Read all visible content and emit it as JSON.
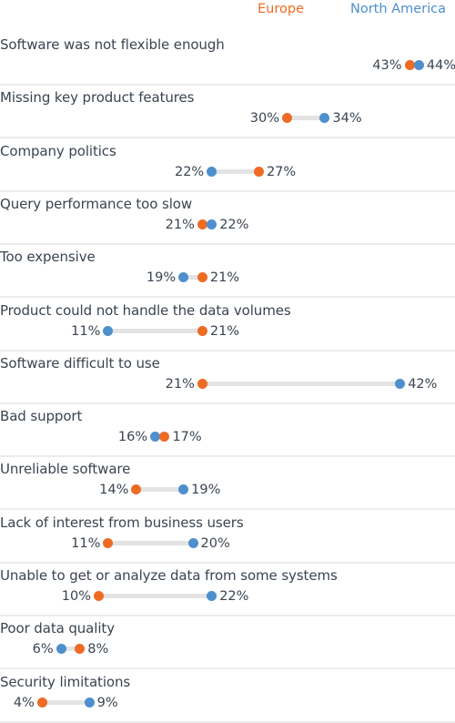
{
  "legend": {
    "europe_label": "Europe",
    "north_america_label": "North America"
  },
  "colors": {
    "europe": "#ee6b24",
    "north_america": "#4e8fce",
    "track": "#e3e3e3",
    "text": "#3a4450",
    "divider": "#ececec"
  },
  "chart_data": {
    "type": "dumbbell",
    "title": "",
    "xlabel": "",
    "ylabel": "",
    "unit": "%",
    "xlim": [
      0,
      48
    ],
    "grid": false,
    "legend_position": "top-right",
    "series": [
      {
        "name": "Europe",
        "color": "#ee6b24",
        "values": [
          43,
          30,
          27,
          21,
          21,
          21,
          21,
          17,
          14,
          11,
          10,
          8,
          4
        ]
      },
      {
        "name": "North America",
        "color": "#4e8fce",
        "values": [
          44,
          34,
          22,
          22,
          19,
          11,
          42,
          16,
          19,
          20,
          22,
          6,
          9
        ]
      }
    ],
    "categories": [
      "Software was not flexible enough",
      "Missing key product features",
      "Company politics",
      "Query performance too slow",
      "Too expensive",
      "Product could not handle the data volumes",
      "Software difficult to use",
      "Bad support",
      "Unreliable software",
      "Lack of interest from business users",
      "Unable to get or analyze data from some systems",
      "Poor data quality",
      "Security limitations"
    ]
  }
}
